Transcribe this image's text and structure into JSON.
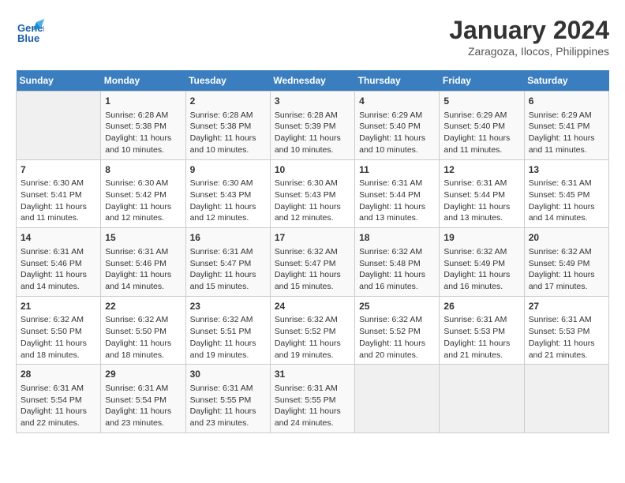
{
  "header": {
    "logo_line1": "General",
    "logo_line2": "Blue",
    "month": "January 2024",
    "location": "Zaragoza, Ilocos, Philippines"
  },
  "days_of_week": [
    "Sunday",
    "Monday",
    "Tuesday",
    "Wednesday",
    "Thursday",
    "Friday",
    "Saturday"
  ],
  "weeks": [
    [
      {
        "day": "",
        "info": ""
      },
      {
        "day": "1",
        "info": "Sunrise: 6:28 AM\nSunset: 5:38 PM\nDaylight: 11 hours\nand 10 minutes."
      },
      {
        "day": "2",
        "info": "Sunrise: 6:28 AM\nSunset: 5:38 PM\nDaylight: 11 hours\nand 10 minutes."
      },
      {
        "day": "3",
        "info": "Sunrise: 6:28 AM\nSunset: 5:39 PM\nDaylight: 11 hours\nand 10 minutes."
      },
      {
        "day": "4",
        "info": "Sunrise: 6:29 AM\nSunset: 5:40 PM\nDaylight: 11 hours\nand 10 minutes."
      },
      {
        "day": "5",
        "info": "Sunrise: 6:29 AM\nSunset: 5:40 PM\nDaylight: 11 hours\nand 11 minutes."
      },
      {
        "day": "6",
        "info": "Sunrise: 6:29 AM\nSunset: 5:41 PM\nDaylight: 11 hours\nand 11 minutes."
      }
    ],
    [
      {
        "day": "7",
        "info": "Sunrise: 6:30 AM\nSunset: 5:41 PM\nDaylight: 11 hours\nand 11 minutes."
      },
      {
        "day": "8",
        "info": "Sunrise: 6:30 AM\nSunset: 5:42 PM\nDaylight: 11 hours\nand 12 minutes."
      },
      {
        "day": "9",
        "info": "Sunrise: 6:30 AM\nSunset: 5:43 PM\nDaylight: 11 hours\nand 12 minutes."
      },
      {
        "day": "10",
        "info": "Sunrise: 6:30 AM\nSunset: 5:43 PM\nDaylight: 11 hours\nand 12 minutes."
      },
      {
        "day": "11",
        "info": "Sunrise: 6:31 AM\nSunset: 5:44 PM\nDaylight: 11 hours\nand 13 minutes."
      },
      {
        "day": "12",
        "info": "Sunrise: 6:31 AM\nSunset: 5:44 PM\nDaylight: 11 hours\nand 13 minutes."
      },
      {
        "day": "13",
        "info": "Sunrise: 6:31 AM\nSunset: 5:45 PM\nDaylight: 11 hours\nand 14 minutes."
      }
    ],
    [
      {
        "day": "14",
        "info": "Sunrise: 6:31 AM\nSunset: 5:46 PM\nDaylight: 11 hours\nand 14 minutes."
      },
      {
        "day": "15",
        "info": "Sunrise: 6:31 AM\nSunset: 5:46 PM\nDaylight: 11 hours\nand 14 minutes."
      },
      {
        "day": "16",
        "info": "Sunrise: 6:31 AM\nSunset: 5:47 PM\nDaylight: 11 hours\nand 15 minutes."
      },
      {
        "day": "17",
        "info": "Sunrise: 6:32 AM\nSunset: 5:47 PM\nDaylight: 11 hours\nand 15 minutes."
      },
      {
        "day": "18",
        "info": "Sunrise: 6:32 AM\nSunset: 5:48 PM\nDaylight: 11 hours\nand 16 minutes."
      },
      {
        "day": "19",
        "info": "Sunrise: 6:32 AM\nSunset: 5:49 PM\nDaylight: 11 hours\nand 16 minutes."
      },
      {
        "day": "20",
        "info": "Sunrise: 6:32 AM\nSunset: 5:49 PM\nDaylight: 11 hours\nand 17 minutes."
      }
    ],
    [
      {
        "day": "21",
        "info": "Sunrise: 6:32 AM\nSunset: 5:50 PM\nDaylight: 11 hours\nand 18 minutes."
      },
      {
        "day": "22",
        "info": "Sunrise: 6:32 AM\nSunset: 5:50 PM\nDaylight: 11 hours\nand 18 minutes."
      },
      {
        "day": "23",
        "info": "Sunrise: 6:32 AM\nSunset: 5:51 PM\nDaylight: 11 hours\nand 19 minutes."
      },
      {
        "day": "24",
        "info": "Sunrise: 6:32 AM\nSunset: 5:52 PM\nDaylight: 11 hours\nand 19 minutes."
      },
      {
        "day": "25",
        "info": "Sunrise: 6:32 AM\nSunset: 5:52 PM\nDaylight: 11 hours\nand 20 minutes."
      },
      {
        "day": "26",
        "info": "Sunrise: 6:31 AM\nSunset: 5:53 PM\nDaylight: 11 hours\nand 21 minutes."
      },
      {
        "day": "27",
        "info": "Sunrise: 6:31 AM\nSunset: 5:53 PM\nDaylight: 11 hours\nand 21 minutes."
      }
    ],
    [
      {
        "day": "28",
        "info": "Sunrise: 6:31 AM\nSunset: 5:54 PM\nDaylight: 11 hours\nand 22 minutes."
      },
      {
        "day": "29",
        "info": "Sunrise: 6:31 AM\nSunset: 5:54 PM\nDaylight: 11 hours\nand 23 minutes."
      },
      {
        "day": "30",
        "info": "Sunrise: 6:31 AM\nSunset: 5:55 PM\nDaylight: 11 hours\nand 23 minutes."
      },
      {
        "day": "31",
        "info": "Sunrise: 6:31 AM\nSunset: 5:55 PM\nDaylight: 11 hours\nand 24 minutes."
      },
      {
        "day": "",
        "info": ""
      },
      {
        "day": "",
        "info": ""
      },
      {
        "day": "",
        "info": ""
      }
    ]
  ]
}
